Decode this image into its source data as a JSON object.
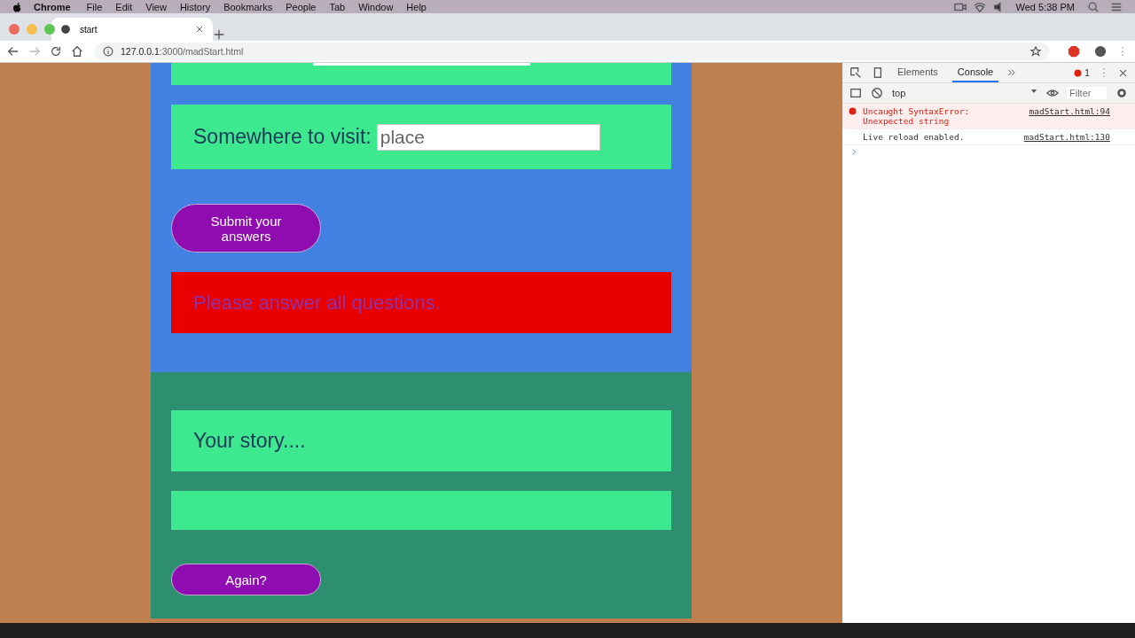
{
  "menubar": {
    "app": "Chrome",
    "items": [
      "File",
      "Edit",
      "View",
      "History",
      "Bookmarks",
      "People",
      "Tab",
      "Window",
      "Help"
    ],
    "clock": "Wed 5:38 PM"
  },
  "browser": {
    "tab_title": "start",
    "url_host": "127.0.0.1",
    "url_path": ":3000/madStart.html"
  },
  "page": {
    "questions": [
      {
        "label": "Somewhere to visit:",
        "placeholder": "place"
      }
    ],
    "submit": "Submit your answers",
    "error": "Please answer all questions.",
    "story_title": "Your story....",
    "again": "Again?"
  },
  "devtools": {
    "tabs": [
      {
        "label": "Elements",
        "selected": false
      },
      {
        "label": "Console",
        "selected": true
      }
    ],
    "error_count": "1",
    "context": "top",
    "filter_placeholder": "Filter",
    "messages": [
      {
        "kind": "error",
        "text": "Uncaught SyntaxError:\nUnexpected string",
        "source": "madStart.html:94"
      },
      {
        "kind": "log",
        "text": "Live reload enabled.",
        "source": "madStart.html:130"
      }
    ]
  }
}
